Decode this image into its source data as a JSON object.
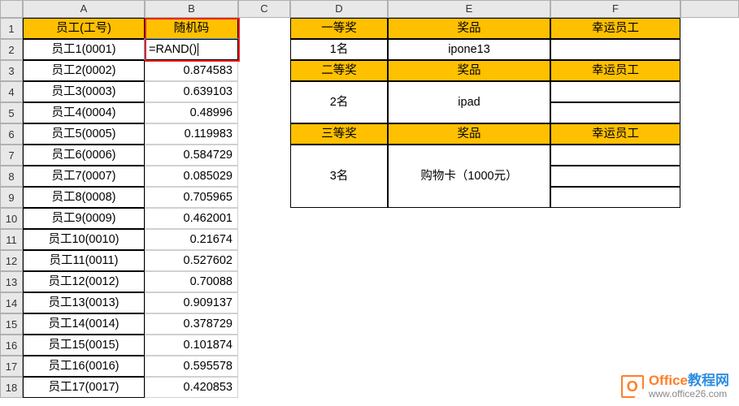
{
  "columns": [
    "A",
    "B",
    "C",
    "D",
    "E",
    "F"
  ],
  "row_count": 18,
  "colA_header": "员工(工号)",
  "colB_header": "随机码",
  "editing_cell": "=RAND()",
  "employees": [
    "员工1(0001)",
    "员工2(0002)",
    "员工3(0003)",
    "员工4(0004)",
    "员工5(0005)",
    "员工6(0006)",
    "员工7(0007)",
    "员工8(0008)",
    "员工9(0009)",
    "员工10(0010)",
    "员工11(0011)",
    "员工12(0012)",
    "员工13(0013)",
    "员工14(0014)",
    "员工15(0015)",
    "员工16(0016)",
    "员工17(0017)"
  ],
  "rand_values": [
    "0.874583",
    "0.639103",
    "0.48996",
    "0.119983",
    "0.584729",
    "0.085029",
    "0.705965",
    "0.462001",
    "0.21674",
    "0.527602",
    "0.70088",
    "0.909137",
    "0.378729",
    "0.101874",
    "0.595578",
    "0.420853"
  ],
  "prize": {
    "tier1_header": "一等奖",
    "tier2_header": "二等奖",
    "tier3_header": "三等奖",
    "prize_label": "奖品",
    "lucky_label": "幸运员工",
    "tier1_count": "1名",
    "tier1_prize": "ipone13",
    "tier2_count": "2名",
    "tier2_prize": "ipad",
    "tier3_count": "3名",
    "tier3_prize": "购物卡（1000元）"
  },
  "watermark": {
    "brand_orange": "Office",
    "brand_blue": "教程网",
    "domain": "www.office26.com",
    "logo_letter": "O"
  },
  "highlight_color": "#ffc000"
}
